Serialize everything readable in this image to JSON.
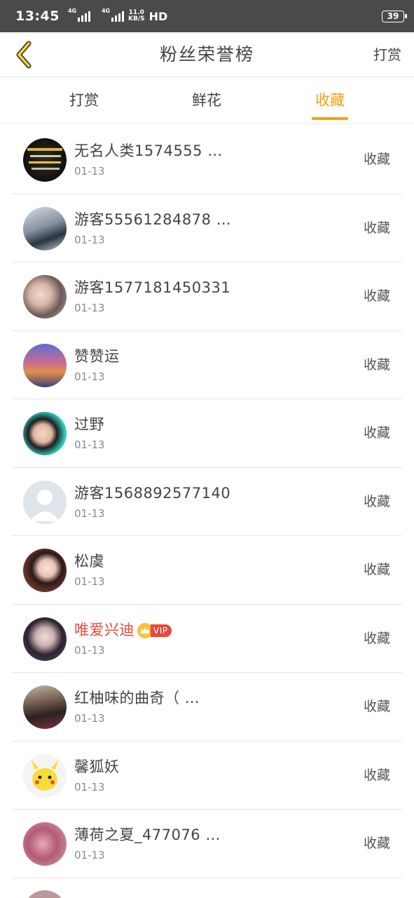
{
  "status_bar": {
    "time": "13:45",
    "net1": "4G",
    "net2": "4G",
    "speed_value": "11.0",
    "speed_unit": "KB/S",
    "hd": "HD",
    "battery": "39"
  },
  "header": {
    "back_icon": "chevron-left-icon",
    "title": "粉丝荣誉榜",
    "action": "打赏"
  },
  "tabs": [
    {
      "label": "打赏",
      "active": false
    },
    {
      "label": "鲜花",
      "active": false
    },
    {
      "label": "收藏",
      "active": true
    }
  ],
  "colors": {
    "accent": "#f0a116",
    "vip_red": "#e8483b",
    "status_bar": "#4a4a4a"
  },
  "rows": [
    {
      "name": "无名人类1574555 …",
      "date": "01-13",
      "action": "收藏",
      "vip": false
    },
    {
      "name": "游客55561284878 …",
      "date": "01-13",
      "action": "收藏",
      "vip": false
    },
    {
      "name": "游客1577181450331",
      "date": "01-13",
      "action": "收藏",
      "vip": false
    },
    {
      "name": "赞赞运",
      "date": "01-13",
      "action": "收藏",
      "vip": false
    },
    {
      "name": "过野",
      "date": "01-13",
      "action": "收藏",
      "vip": false
    },
    {
      "name": "游客1568892577140",
      "date": "01-13",
      "action": "收藏",
      "vip": false
    },
    {
      "name": "松虞",
      "date": "01-13",
      "action": "收藏",
      "vip": false
    },
    {
      "name": "唯爱兴迪",
      "date": "01-13",
      "action": "收藏",
      "vip": true,
      "vip_label": "VIP"
    },
    {
      "name": "红柚味的曲奇（ …",
      "date": "01-13",
      "action": "收藏",
      "vip": false
    },
    {
      "name": "馨狐妖",
      "date": "01-13",
      "action": "收藏",
      "vip": false
    },
    {
      "name": "薄荷之夏_477076 …",
      "date": "01-13",
      "action": "收藏",
      "vip": false
    }
  ]
}
